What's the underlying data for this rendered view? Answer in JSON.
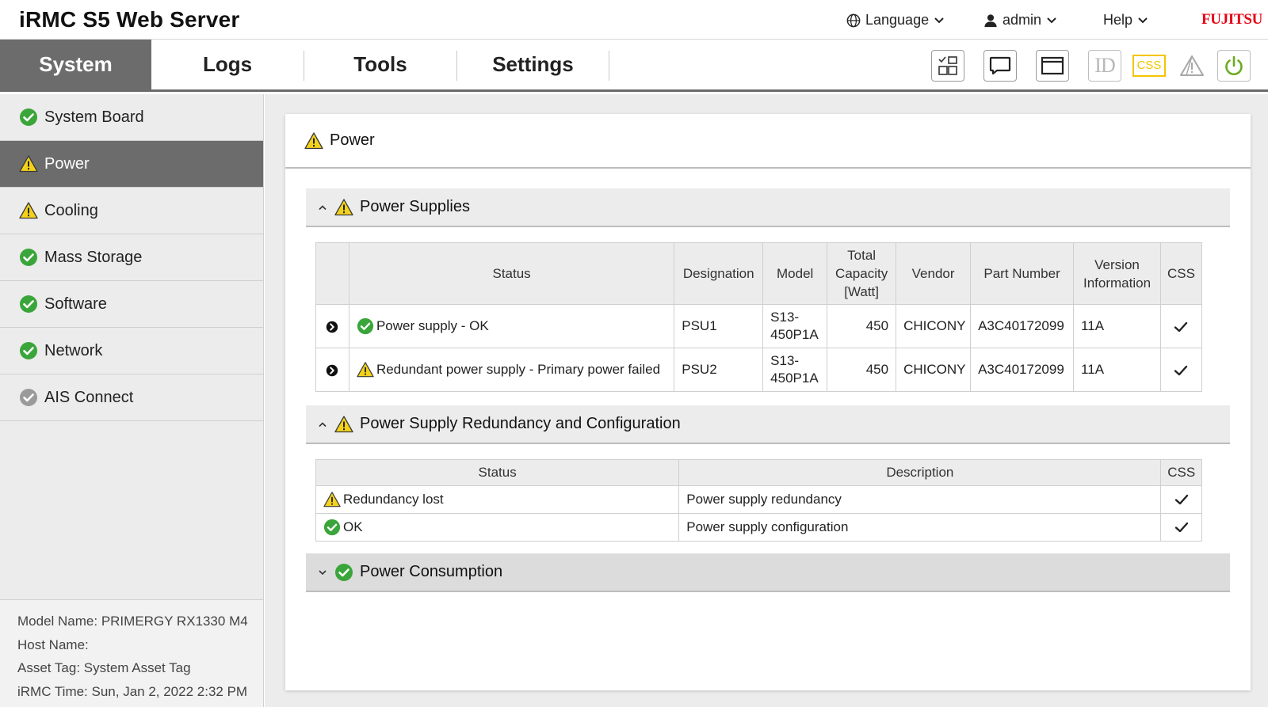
{
  "app": {
    "title": "iRMC S5 Web Server",
    "brand": "FUJITSU"
  },
  "topmenu": {
    "language": "Language",
    "user": "admin",
    "help": "Help"
  },
  "tabs": [
    "System",
    "Logs",
    "Tools",
    "Settings"
  ],
  "toolbar": {
    "icons": [
      "dashboard-icon",
      "chat-icon",
      "window-icon",
      "id-icon",
      "css-icon",
      "alert-icon",
      "power-icon"
    ],
    "id_label": "ID",
    "css_label": "CSS",
    "css_color": "#f5c400",
    "power_color": "#6aab1f"
  },
  "sidebar": {
    "items": [
      {
        "label": "System Board",
        "status": "ok"
      },
      {
        "label": "Power",
        "status": "warning"
      },
      {
        "label": "Cooling",
        "status": "warning"
      },
      {
        "label": "Mass Storage",
        "status": "ok"
      },
      {
        "label": "Software",
        "status": "ok"
      },
      {
        "label": "Network",
        "status": "ok"
      },
      {
        "label": "AIS Connect",
        "status": "disabled"
      }
    ],
    "info": {
      "model": "Model Name: PRIMERGY RX1330 M4",
      "host": "Host Name:",
      "asset": "Asset Tag: System Asset Tag",
      "time": "iRMC Time: Sun, Jan 2, 2022 2:32 PM"
    }
  },
  "panel": {
    "title": "Power",
    "status": "warning"
  },
  "sections": {
    "supplies": {
      "title": "Power Supplies",
      "status": "warning",
      "expanded": true
    },
    "redundancy": {
      "title": "Power Supply Redundancy and Configuration",
      "status": "warning",
      "expanded": true
    },
    "consumption": {
      "title": "Power Consumption",
      "status": "ok",
      "expanded": false
    }
  },
  "supplies_table": {
    "headers": {
      "status": "Status",
      "designation": "Designation",
      "model": "Model",
      "capacity_1": "Total",
      "capacity_2": "Capacity",
      "capacity_3": "[Watt]",
      "vendor": "Vendor",
      "part": "Part Number",
      "version_1": "Version",
      "version_2": "Information",
      "css": "CSS"
    },
    "rows": [
      {
        "status": "Power supply - OK",
        "state": "ok",
        "designation": "PSU1",
        "model_1": "S13-",
        "model_2": "450P1A",
        "capacity": "450",
        "vendor": "CHICONY",
        "part": "A3C40172099",
        "version": "11A",
        "css": true
      },
      {
        "status": "Redundant power supply - Primary power failed",
        "state": "warning",
        "designation": "PSU2",
        "model_1": "S13-",
        "model_2": "450P1A",
        "capacity": "450",
        "vendor": "CHICONY",
        "part": "A3C40172099",
        "version": "11A",
        "css": true
      }
    ]
  },
  "redundancy_table": {
    "headers": {
      "status": "Status",
      "description": "Description",
      "css": "CSS"
    },
    "rows": [
      {
        "status": "Redundancy lost",
        "state": "warning",
        "description": "Power supply redundancy",
        "css": true
      },
      {
        "status": "OK",
        "state": "ok",
        "description": "Power supply configuration",
        "css": true
      }
    ]
  },
  "colors": {
    "ok": "#3aa53a",
    "warning": "#f3d21a",
    "active_nav": "#6c6c6c"
  }
}
